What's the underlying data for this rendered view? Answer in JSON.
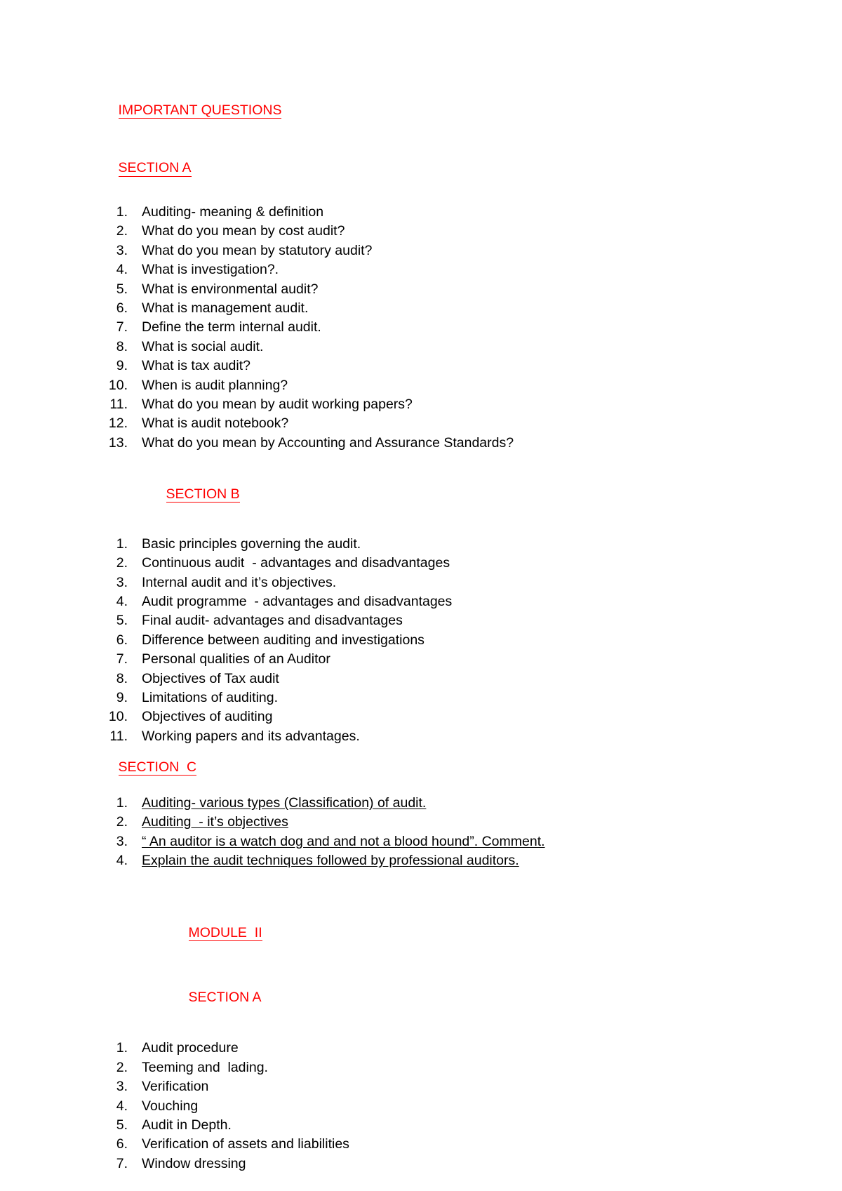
{
  "document": {
    "title": "IMPORTANT QUESTIONS",
    "accent_color": "#ff0000",
    "text_color": "#000000",
    "background_color": "#ffffff"
  },
  "headings": {
    "important_questions": "IMPORTANT QUESTIONS",
    "section_a": "SECTION A",
    "section_b": "SECTION B",
    "section_c": "SECTION  C",
    "module_ii": "MODULE  II",
    "module_ii_section_a": "SECTION A"
  },
  "sections": {
    "module1_section_a": {
      "heading": "SECTION A",
      "items": [
        "Auditing- meaning & definition",
        "What do you mean by cost audit?",
        "What do you mean by statutory audit?",
        "What is investigation?.",
        "What is environmental audit?",
        "What is management audit.",
        "Define the term internal audit.",
        "What is social audit.",
        "What is tax audit?",
        "When is audit planning?",
        "What do you mean by audit working papers?",
        "What is audit notebook?",
        "What do you mean by Accounting and Assurance Standards?"
      ],
      "markers": [
        "1.",
        "2.",
        "3.",
        "4.",
        "5.",
        "6.",
        "7.",
        "8.",
        "9.",
        "10.",
        "11.",
        "12.",
        "13."
      ]
    },
    "module1_section_b": {
      "heading": "SECTION B",
      "items": [
        "Basic principles governing the audit.",
        "Continuous audit  - advantages and disadvantages",
        "Internal audit and it’s objectives.",
        "Audit programme  - advantages and disadvantages",
        "Final audit- advantages and disadvantages",
        "Difference between auditing and investigations",
        "Personal qualities of an Auditor",
        "Objectives of Tax audit",
        "Limitations of auditing.",
        "Objectives of auditing",
        "Working papers and its advantages."
      ],
      "markers": [
        "1.",
        "2.",
        "3.",
        "4.",
        "5.",
        "6.",
        "7.",
        "8.",
        "9.",
        "10.",
        "11."
      ]
    },
    "module1_section_c": {
      "heading": "SECTION  C",
      "items": [
        "Auditing- various types (Classification) of audit.",
        "Auditing  - it’s objectives",
        "“ An auditor is a watch dog and and not a blood hound”. Comment.",
        "Explain the audit techniques followed by professional auditors."
      ],
      "markers": [
        "1.",
        "2.",
        "3.",
        "4."
      ]
    },
    "module2_section_a": {
      "heading": "SECTION A",
      "items": [
        "Audit procedure",
        "Teeming and  lading.",
        "Verification",
        "Vouching",
        "Audit in Depth.",
        "Verification of assets and liabilities",
        "Window dressing"
      ],
      "markers": [
        "1.",
        "2.",
        "3.",
        "4.",
        "5.",
        "6.",
        "7."
      ]
    }
  }
}
